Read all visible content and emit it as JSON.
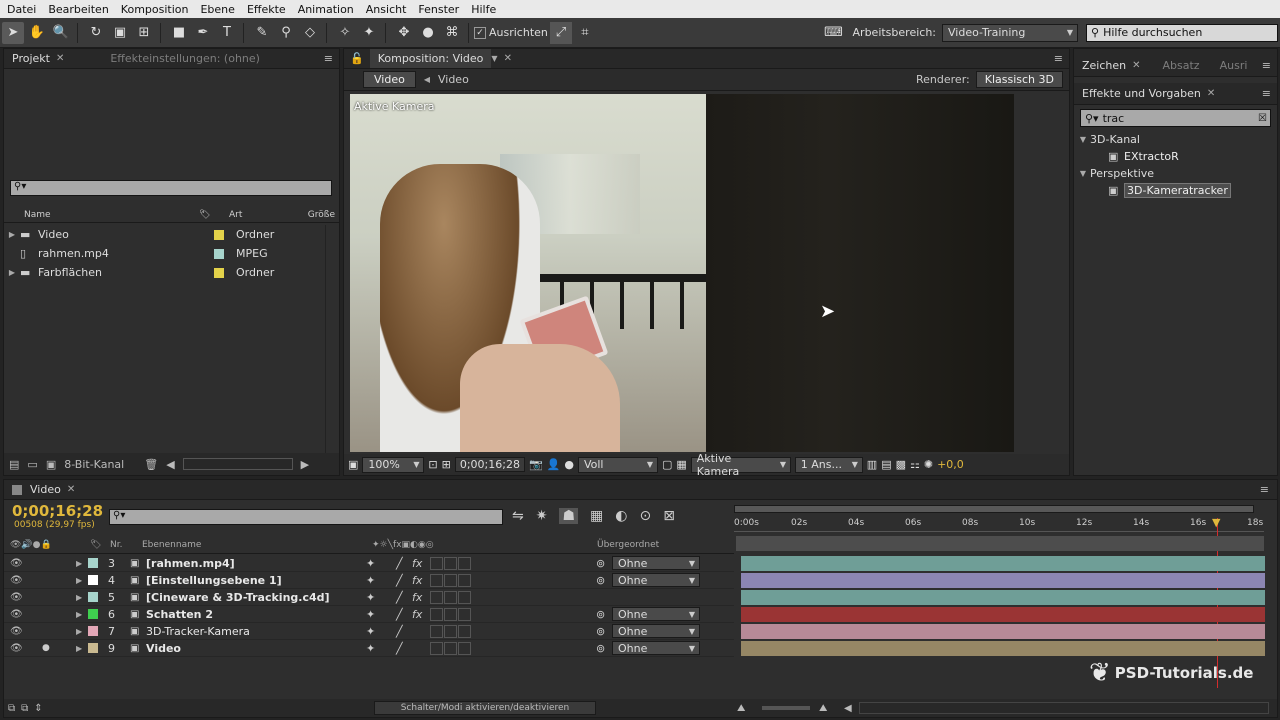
{
  "menu": [
    "Datei",
    "Bearbeiten",
    "Komposition",
    "Ebene",
    "Effekte",
    "Animation",
    "Ansicht",
    "Fenster",
    "Hilfe"
  ],
  "toolbar": {
    "align_label": "Ausrichten",
    "workspace_label": "Arbeitsbereich:",
    "workspace_value": "Video-Training",
    "help_placeholder": "Hilfe durchsuchen"
  },
  "project": {
    "tab": "Projekt",
    "tab2": "Effekteinstellungen: (ohne)",
    "columns": {
      "name": "Name",
      "type": "Art",
      "size": "Größe"
    },
    "items": [
      {
        "name": "Video",
        "type": "Ordner",
        "color": "#e3d24a"
      },
      {
        "name": "rahmen.mp4",
        "type": "MPEG",
        "color": "#a7d4cc"
      },
      {
        "name": "Farbflächen",
        "type": "Ordner",
        "color": "#e3d24a"
      }
    ],
    "bitdepth": "8-Bit-Kanal"
  },
  "comp": {
    "tab": "Komposition: Video",
    "crumb1": "Video",
    "crumb2": "Video",
    "renderer_label": "Renderer:",
    "renderer_value": "Klassisch 3D",
    "camera_overlay": "Aktive Kamera",
    "zoom": "100%",
    "timecode": "0;00;16;28",
    "quality": "Voll",
    "view": "Aktive Kamera",
    "views": "1 Ans...",
    "exposure": "+0,0"
  },
  "right": {
    "tab1": "Zeichen",
    "tab2": "Absatz",
    "tab3": "Ausri",
    "effects_tab": "Effekte und Vorgaben",
    "search": "trac",
    "tree": [
      {
        "cat": "3D-Kanal",
        "items": [
          "EXtractoR"
        ]
      },
      {
        "cat": "Perspektive",
        "items": [
          "3D-Kameratracker"
        ]
      }
    ]
  },
  "timeline": {
    "tab": "Video",
    "timecode": "0;00;16;28",
    "frames": "00508 (29,97 fps)",
    "col_nr": "Nr.",
    "col_name": "Ebenenname",
    "col_parent": "Übergeordnet",
    "ruler": [
      "0:00s",
      "02s",
      "04s",
      "06s",
      "08s",
      "10s",
      "12s",
      "14s",
      "16s",
      "18s"
    ],
    "layers": [
      {
        "nr": "3",
        "name": "[rahmen.mp4]",
        "color": "#a7d4cc",
        "parent": "Ohne",
        "bar": "#6f9e97"
      },
      {
        "nr": "4",
        "name": "[Einstellungsebene 1]",
        "color": "#ffffff",
        "parent": "Ohne",
        "bar": "#8c86b3"
      },
      {
        "nr": "5",
        "name": "[Cineware & 3D-Tracking.c4d]",
        "color": "#a7d4cc",
        "parent": "",
        "bar": "#6f9e97"
      },
      {
        "nr": "6",
        "name": "Schatten 2",
        "color": "#3fcf4f",
        "parent": "Ohne",
        "bar": "#9a3434"
      },
      {
        "nr": "7",
        "name": "3D-Tracker-Kamera",
        "color": "#e3a7b7",
        "parent": "Ohne",
        "bar": "#b78a97"
      },
      {
        "nr": "9",
        "name": "Video",
        "color": "#c9b990",
        "parent": "Ohne",
        "bar": "#968765"
      }
    ],
    "toggle": "Schalter/Modi aktivieren/deaktivieren"
  },
  "watermark": "PSD-Tutorials.de"
}
